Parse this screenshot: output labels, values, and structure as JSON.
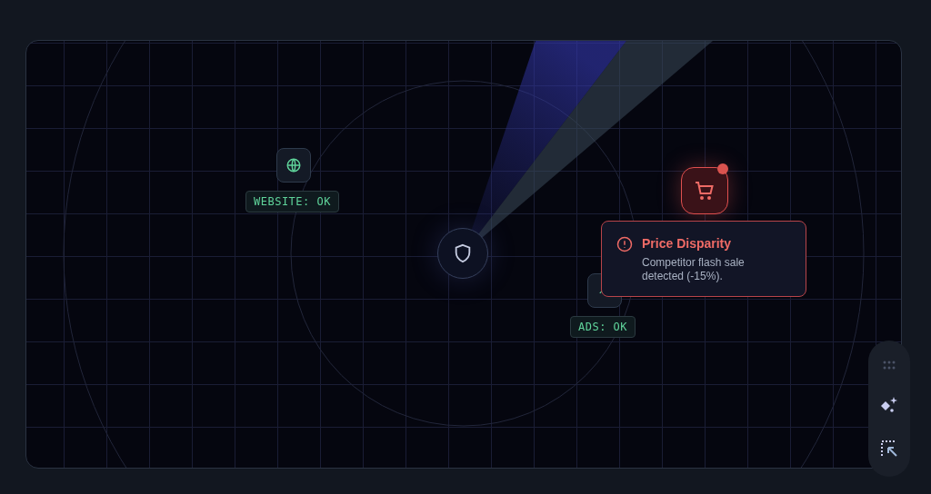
{
  "nodes": [
    {
      "kind": "website",
      "label": "WEBSITE: OK"
    },
    {
      "kind": "ads",
      "label": "ADS: OK"
    },
    {
      "kind": "cart",
      "alert": true
    }
  ],
  "alert": {
    "title": "Price Disparity",
    "message": "Competitor flash sale detected (-15%)."
  },
  "toolbar": [
    {
      "kind": "grid"
    },
    {
      "kind": "sparkle"
    },
    {
      "kind": "select"
    }
  ]
}
